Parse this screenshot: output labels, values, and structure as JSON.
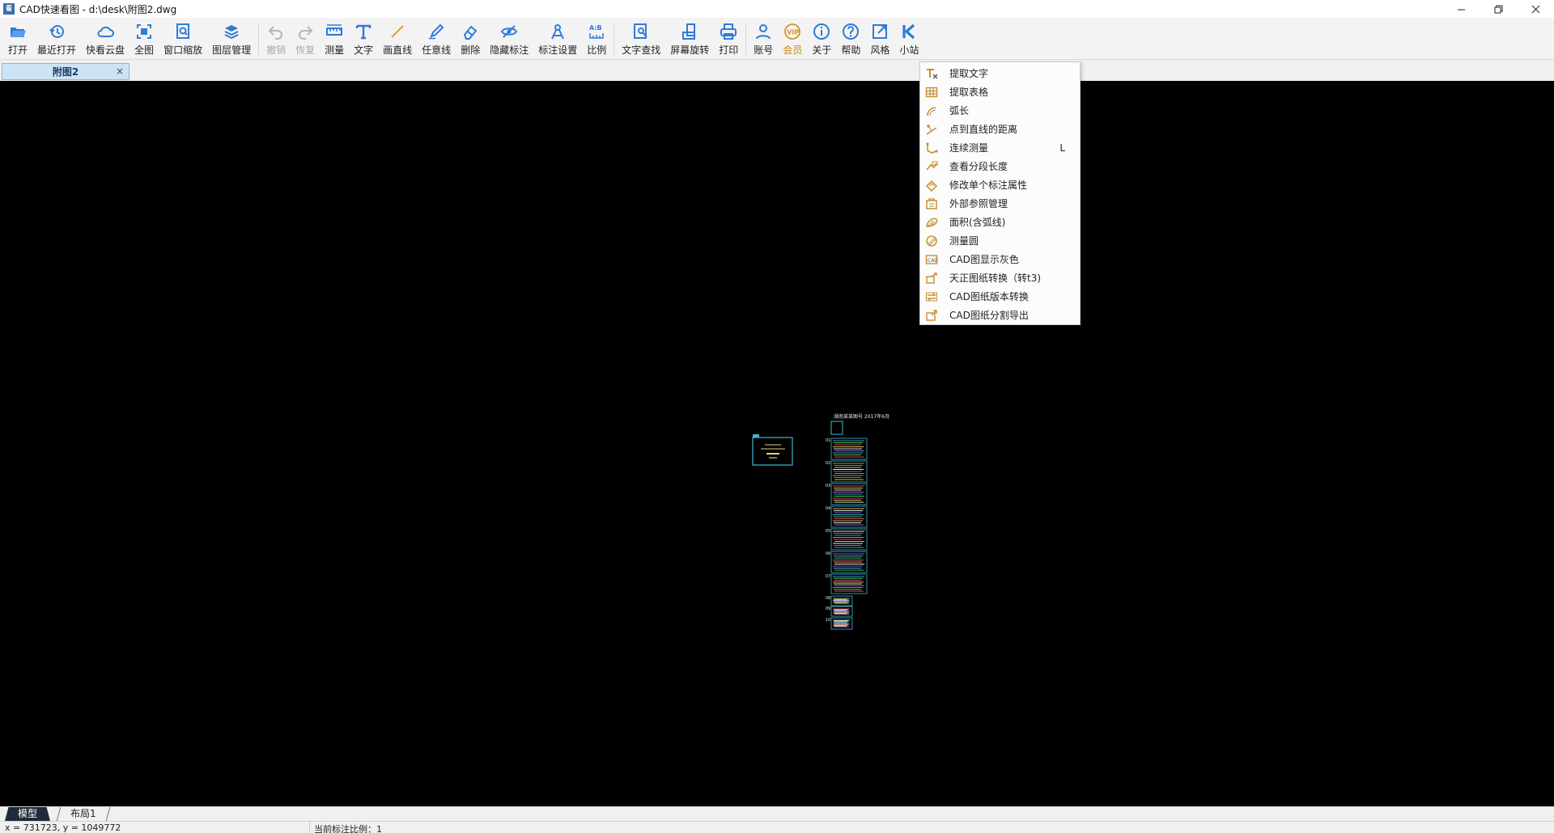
{
  "window": {
    "title": "CAD快速看图 - d:\\desk\\附图2.dwg",
    "app_icon_text": "看",
    "controls": [
      "minimize-icon",
      "restore-icon",
      "close-icon"
    ]
  },
  "toolbar": {
    "groups": [
      [
        {
          "id": "open",
          "label": "打开",
          "icon": "folder-open-icon",
          "color": "#2f7bd8"
        },
        {
          "id": "recent",
          "label": "最近打开",
          "icon": "history-icon",
          "color": "#2f7bd8"
        },
        {
          "id": "cloud",
          "label": "快看云盘",
          "icon": "cloud-icon",
          "color": "#2f7bd8"
        },
        {
          "id": "fullview",
          "label": "全图",
          "icon": "fit-view-icon",
          "color": "#2f7bd8"
        },
        {
          "id": "windowzoom",
          "label": "窗口缩放",
          "icon": "zoom-window-icon",
          "color": "#2f7bd8"
        },
        {
          "id": "layers",
          "label": "图层管理",
          "icon": "layers-icon",
          "color": "#2f7bd8"
        }
      ],
      [
        {
          "id": "undo",
          "label": "撤销",
          "icon": "undo-icon",
          "color": "#b5b5b5",
          "disabled": true
        },
        {
          "id": "redo",
          "label": "恢复",
          "icon": "redo-icon",
          "color": "#b5b5b5",
          "disabled": true
        },
        {
          "id": "measure",
          "label": "测量",
          "icon": "ruler-icon",
          "color": "#2f7bd8"
        },
        {
          "id": "text",
          "label": "文字",
          "icon": "text-icon",
          "color": "#2f7bd8"
        },
        {
          "id": "line",
          "label": "画直线",
          "icon": "line-icon",
          "color": "#e8a33b"
        },
        {
          "id": "freeline",
          "label": "任意线",
          "icon": "pen-icon",
          "color": "#2f7bd8"
        },
        {
          "id": "erase",
          "label": "删除",
          "icon": "eraser-icon",
          "color": "#2f7bd8"
        },
        {
          "id": "hidemark",
          "label": "隐藏标注",
          "icon": "eye-off-icon",
          "color": "#2f7bd8"
        },
        {
          "id": "marksettings",
          "label": "标注设置",
          "icon": "mark-settings-icon",
          "color": "#2f7bd8"
        },
        {
          "id": "scale",
          "label": "比例",
          "icon": "scale-icon",
          "color": "#2f7bd8"
        }
      ],
      [
        {
          "id": "findtext",
          "label": "文字查找",
          "icon": "find-text-icon",
          "color": "#2f7bd8"
        },
        {
          "id": "rotate",
          "label": "屏幕旋转",
          "icon": "rotate-screen-icon",
          "color": "#2f7bd8"
        },
        {
          "id": "print",
          "label": "打印",
          "icon": "printer-icon",
          "color": "#2f7bd8"
        }
      ],
      [
        {
          "id": "account",
          "label": "账号",
          "icon": "user-icon",
          "color": "#2f7bd8"
        },
        {
          "id": "vip",
          "label": "会员",
          "icon": "vip-icon",
          "color": "#d4961c",
          "active": true
        },
        {
          "id": "about",
          "label": "关于",
          "icon": "info-icon",
          "color": "#2f7bd8"
        },
        {
          "id": "help",
          "label": "帮助",
          "icon": "help-icon",
          "color": "#2f7bd8"
        },
        {
          "id": "style",
          "label": "风格",
          "icon": "style-icon",
          "color": "#2f7bd8"
        },
        {
          "id": "station",
          "label": "小站",
          "icon": "k-logo-icon",
          "color": "#2f7bd8"
        }
      ]
    ]
  },
  "tabs": {
    "document": "附图2",
    "close_glyph": "×"
  },
  "menu": {
    "items": [
      {
        "label": "提取文字",
        "icon": "extract-text-icon"
      },
      {
        "label": "提取表格",
        "icon": "extract-table-icon"
      },
      {
        "label": "弧长",
        "icon": "arc-length-icon"
      },
      {
        "label": "点到直线的距离",
        "icon": "point-line-distance-icon"
      },
      {
        "label": "连续测量",
        "icon": "continuous-measure-icon",
        "shortcut": "L"
      },
      {
        "label": "查看分段长度",
        "icon": "segment-length-icon"
      },
      {
        "label": "修改单个标注属性",
        "icon": "edit-mark-icon"
      },
      {
        "label": "外部参照管理",
        "icon": "xref-icon"
      },
      {
        "label": "面积(含弧线)",
        "icon": "area-icon"
      },
      {
        "label": "测量圆",
        "icon": "measure-circle-icon"
      },
      {
        "label": "CAD图显示灰色",
        "icon": "gray-display-icon"
      },
      {
        "label": "天正图纸转换（转t3)",
        "icon": "convert-t3-icon"
      },
      {
        "label": "CAD图纸版本转换",
        "icon": "version-convert-icon"
      },
      {
        "label": "CAD图纸分割导出",
        "icon": "split-export-icon"
      }
    ]
  },
  "layout_tabs": {
    "model": "模型",
    "layout1": "布局1"
  },
  "status": {
    "coords": "x = 731723, y = 1049772",
    "scale": "当前标注比例：1"
  },
  "drawing": {
    "header_text": "湖南某某图号   2017年6月",
    "row_numbers": [
      "01",
      "02",
      "03",
      "04",
      "05",
      "06",
      "07",
      "08",
      "09",
      "10"
    ]
  },
  "colors": {
    "accent": "#2f7bd8",
    "vip": "#d4961c",
    "canvas": "#000000",
    "menu_icon": "#c8902a"
  }
}
